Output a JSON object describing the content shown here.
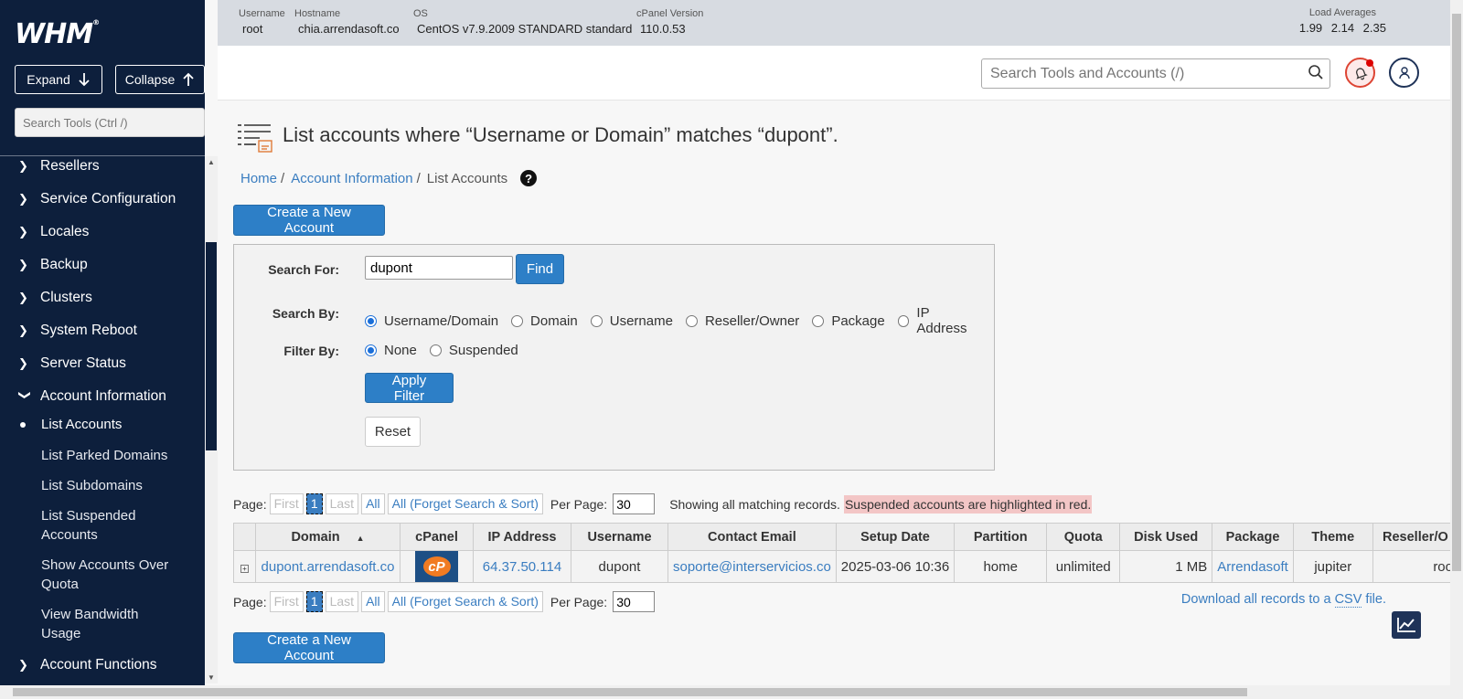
{
  "app": {
    "logo": "WHM",
    "logo_mark": "®"
  },
  "sidebar": {
    "expand_label": "Expand",
    "collapse_label": "Collapse",
    "search_placeholder": "Search Tools (Ctrl /)",
    "items": [
      {
        "label": "Resellers"
      },
      {
        "label": "Service Configuration"
      },
      {
        "label": "Locales"
      },
      {
        "label": "Backup"
      },
      {
        "label": "Clusters"
      },
      {
        "label": "System Reboot"
      },
      {
        "label": "Server Status"
      },
      {
        "label": "Account Information"
      }
    ],
    "subitems": [
      {
        "label": "List Accounts"
      },
      {
        "label": "List Parked Domains"
      },
      {
        "label": "List Subdomains"
      },
      {
        "label": "List Suspended Accounts"
      },
      {
        "label": "Show Accounts Over Quota"
      },
      {
        "label": "View Bandwidth Usage"
      }
    ],
    "bottom_item": "Account Functions"
  },
  "infobar": {
    "username_label": "Username",
    "username": "root",
    "hostname_label": "Hostname",
    "hostname": "chia.arrendasoft.co",
    "os_label": "OS",
    "os": "CentOS v7.9.2009 STANDARD standard",
    "cpanel_label": "cPanel Version",
    "cpanel": "110.0.53",
    "loads_label": "Load Averages",
    "loads": "1.99 2.14 2.35"
  },
  "topbar": {
    "search_placeholder": "Search Tools and Accounts (/)"
  },
  "page": {
    "title": "List accounts where “Username or Domain” matches “dupont”.",
    "breadcrumb": [
      "Home",
      "Account Information",
      "List Accounts"
    ],
    "help": "?",
    "create_label": "Create a New Account"
  },
  "filter": {
    "search_for_label": "Search For:",
    "search_value": "dupont",
    "find_label": "Find",
    "search_by_label": "Search By:",
    "search_by_options": [
      "Username/Domain",
      "Domain",
      "Username",
      "Reseller/Owner",
      "Package",
      "IP Address"
    ],
    "filter_by_label": "Filter By:",
    "filter_by_options": [
      "None",
      "Suspended"
    ],
    "apply_label": "Apply Filter",
    "reset_label": "Reset"
  },
  "pager": {
    "page_label": "Page:",
    "first": "First",
    "current": "1",
    "last": "Last",
    "all": "All",
    "all_forget": "All (Forget Search & Sort)",
    "per_page_label": "Per Page:",
    "per_page": "30",
    "showing": "Showing all matching records.",
    "suspended_note": "Suspended accounts are highlighted in red."
  },
  "table": {
    "columns": [
      "Domain",
      "cPanel",
      "IP Address",
      "Username",
      "Contact Email",
      "Setup Date",
      "Partition",
      "Quota",
      "Disk Used",
      "Package",
      "Theme",
      "Reseller/O"
    ],
    "rows": [
      {
        "expand": "+",
        "domain": "dupont.arrendasoft.co",
        "cpanel": "cP",
        "ip": "64.37.50.114",
        "username": "dupont",
        "email": "soporte@interservicios.co",
        "setup": "2025-03-06 10:36",
        "partition": "home",
        "quota": "unlimited",
        "disk": "1 MB",
        "package": "Arrendasoft",
        "theme": "jupiter",
        "reseller": "roo"
      }
    ]
  },
  "download": {
    "prefix": "Download all records to a ",
    "csv": "CSV",
    "suffix": " file."
  },
  "colors": {
    "sidebar": "#0d1f3c",
    "accent": "#2d7fc7",
    "link": "#3a7dc0",
    "suspended": "#f3c6c6"
  }
}
